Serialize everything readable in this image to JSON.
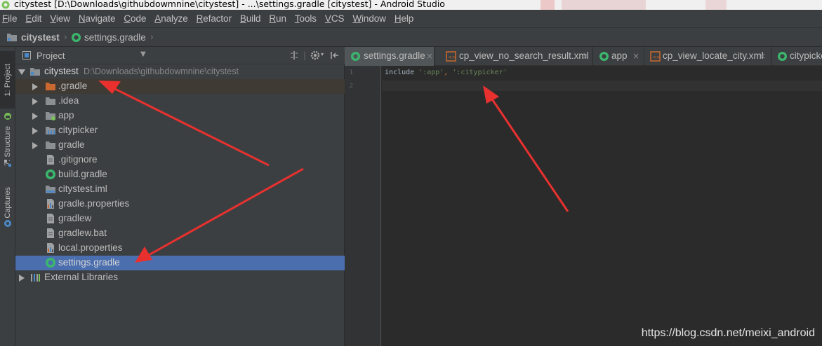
{
  "titlebar": {
    "title": "citystest [D:\\Downloads\\githubdowmnine\\citystest] - ...\\settings.gradle [citystest] - Android Studio"
  },
  "menu": {
    "items": [
      "File",
      "Edit",
      "View",
      "Navigate",
      "Code",
      "Analyze",
      "Refactor",
      "Build",
      "Run",
      "Tools",
      "VCS",
      "Window",
      "Help"
    ]
  },
  "navbar": {
    "crumbs": [
      "citystest",
      "settings.gradle"
    ]
  },
  "toolstrip": {
    "tabs": [
      "1: Project",
      "7: Structure",
      "Captures"
    ]
  },
  "project": {
    "view_label": "Project",
    "root": {
      "name": "citystest",
      "path": "D:\\Downloads\\githubdowmnine\\citystest"
    },
    "items": [
      {
        "label": ".gradle",
        "icon": "folder-orange-icon",
        "expandable": true
      },
      {
        "label": ".idea",
        "icon": "folder-icon",
        "expandable": true
      },
      {
        "label": "app",
        "icon": "module-app-icon",
        "expandable": true
      },
      {
        "label": "citypicker",
        "icon": "module-library-icon",
        "expandable": true
      },
      {
        "label": "gradle",
        "icon": "folder-icon",
        "expandable": true
      },
      {
        "label": ".gitignore",
        "icon": "text-file-icon",
        "expandable": false
      },
      {
        "label": "build.gradle",
        "icon": "gradle-file-icon",
        "expandable": false
      },
      {
        "label": "citystest.iml",
        "icon": "iml-file-icon",
        "expandable": false
      },
      {
        "label": "gradle.properties",
        "icon": "properties-file-icon",
        "expandable": false
      },
      {
        "label": "gradlew",
        "icon": "text-file-icon",
        "expandable": false
      },
      {
        "label": "gradlew.bat",
        "icon": "text-file-icon",
        "expandable": false
      },
      {
        "label": "local.properties",
        "icon": "properties-file-icon",
        "expandable": false
      },
      {
        "label": "settings.gradle",
        "icon": "gradle-file-icon",
        "expandable": false,
        "selected": true
      }
    ],
    "external_libraries": "External Libraries"
  },
  "editor": {
    "tabs": [
      {
        "label": "settings.gradle",
        "icon": "gradle-file-icon",
        "active": true
      },
      {
        "label": "cp_view_no_search_result.xml",
        "icon": "xml-layout-icon"
      },
      {
        "label": "app",
        "icon": "gradle-file-icon"
      },
      {
        "label": "cp_view_locate_city.xml",
        "icon": "xml-layout-icon"
      },
      {
        "label": "citypicke",
        "icon": "gradle-file-icon"
      }
    ],
    "close_glyph": "×",
    "line_numbers": [
      "1",
      "2"
    ],
    "code": {
      "keyword": "include ",
      "str1": "':app'",
      "comma": ", ",
      "str2": "':citypicker'"
    }
  },
  "watermark": "https://blog.csdn.net/meixi_android",
  "colors": {
    "accent_selection": "#4b6eaf",
    "annotation_arrow": "#e8312f",
    "gradle_green": "#3bb76d"
  }
}
